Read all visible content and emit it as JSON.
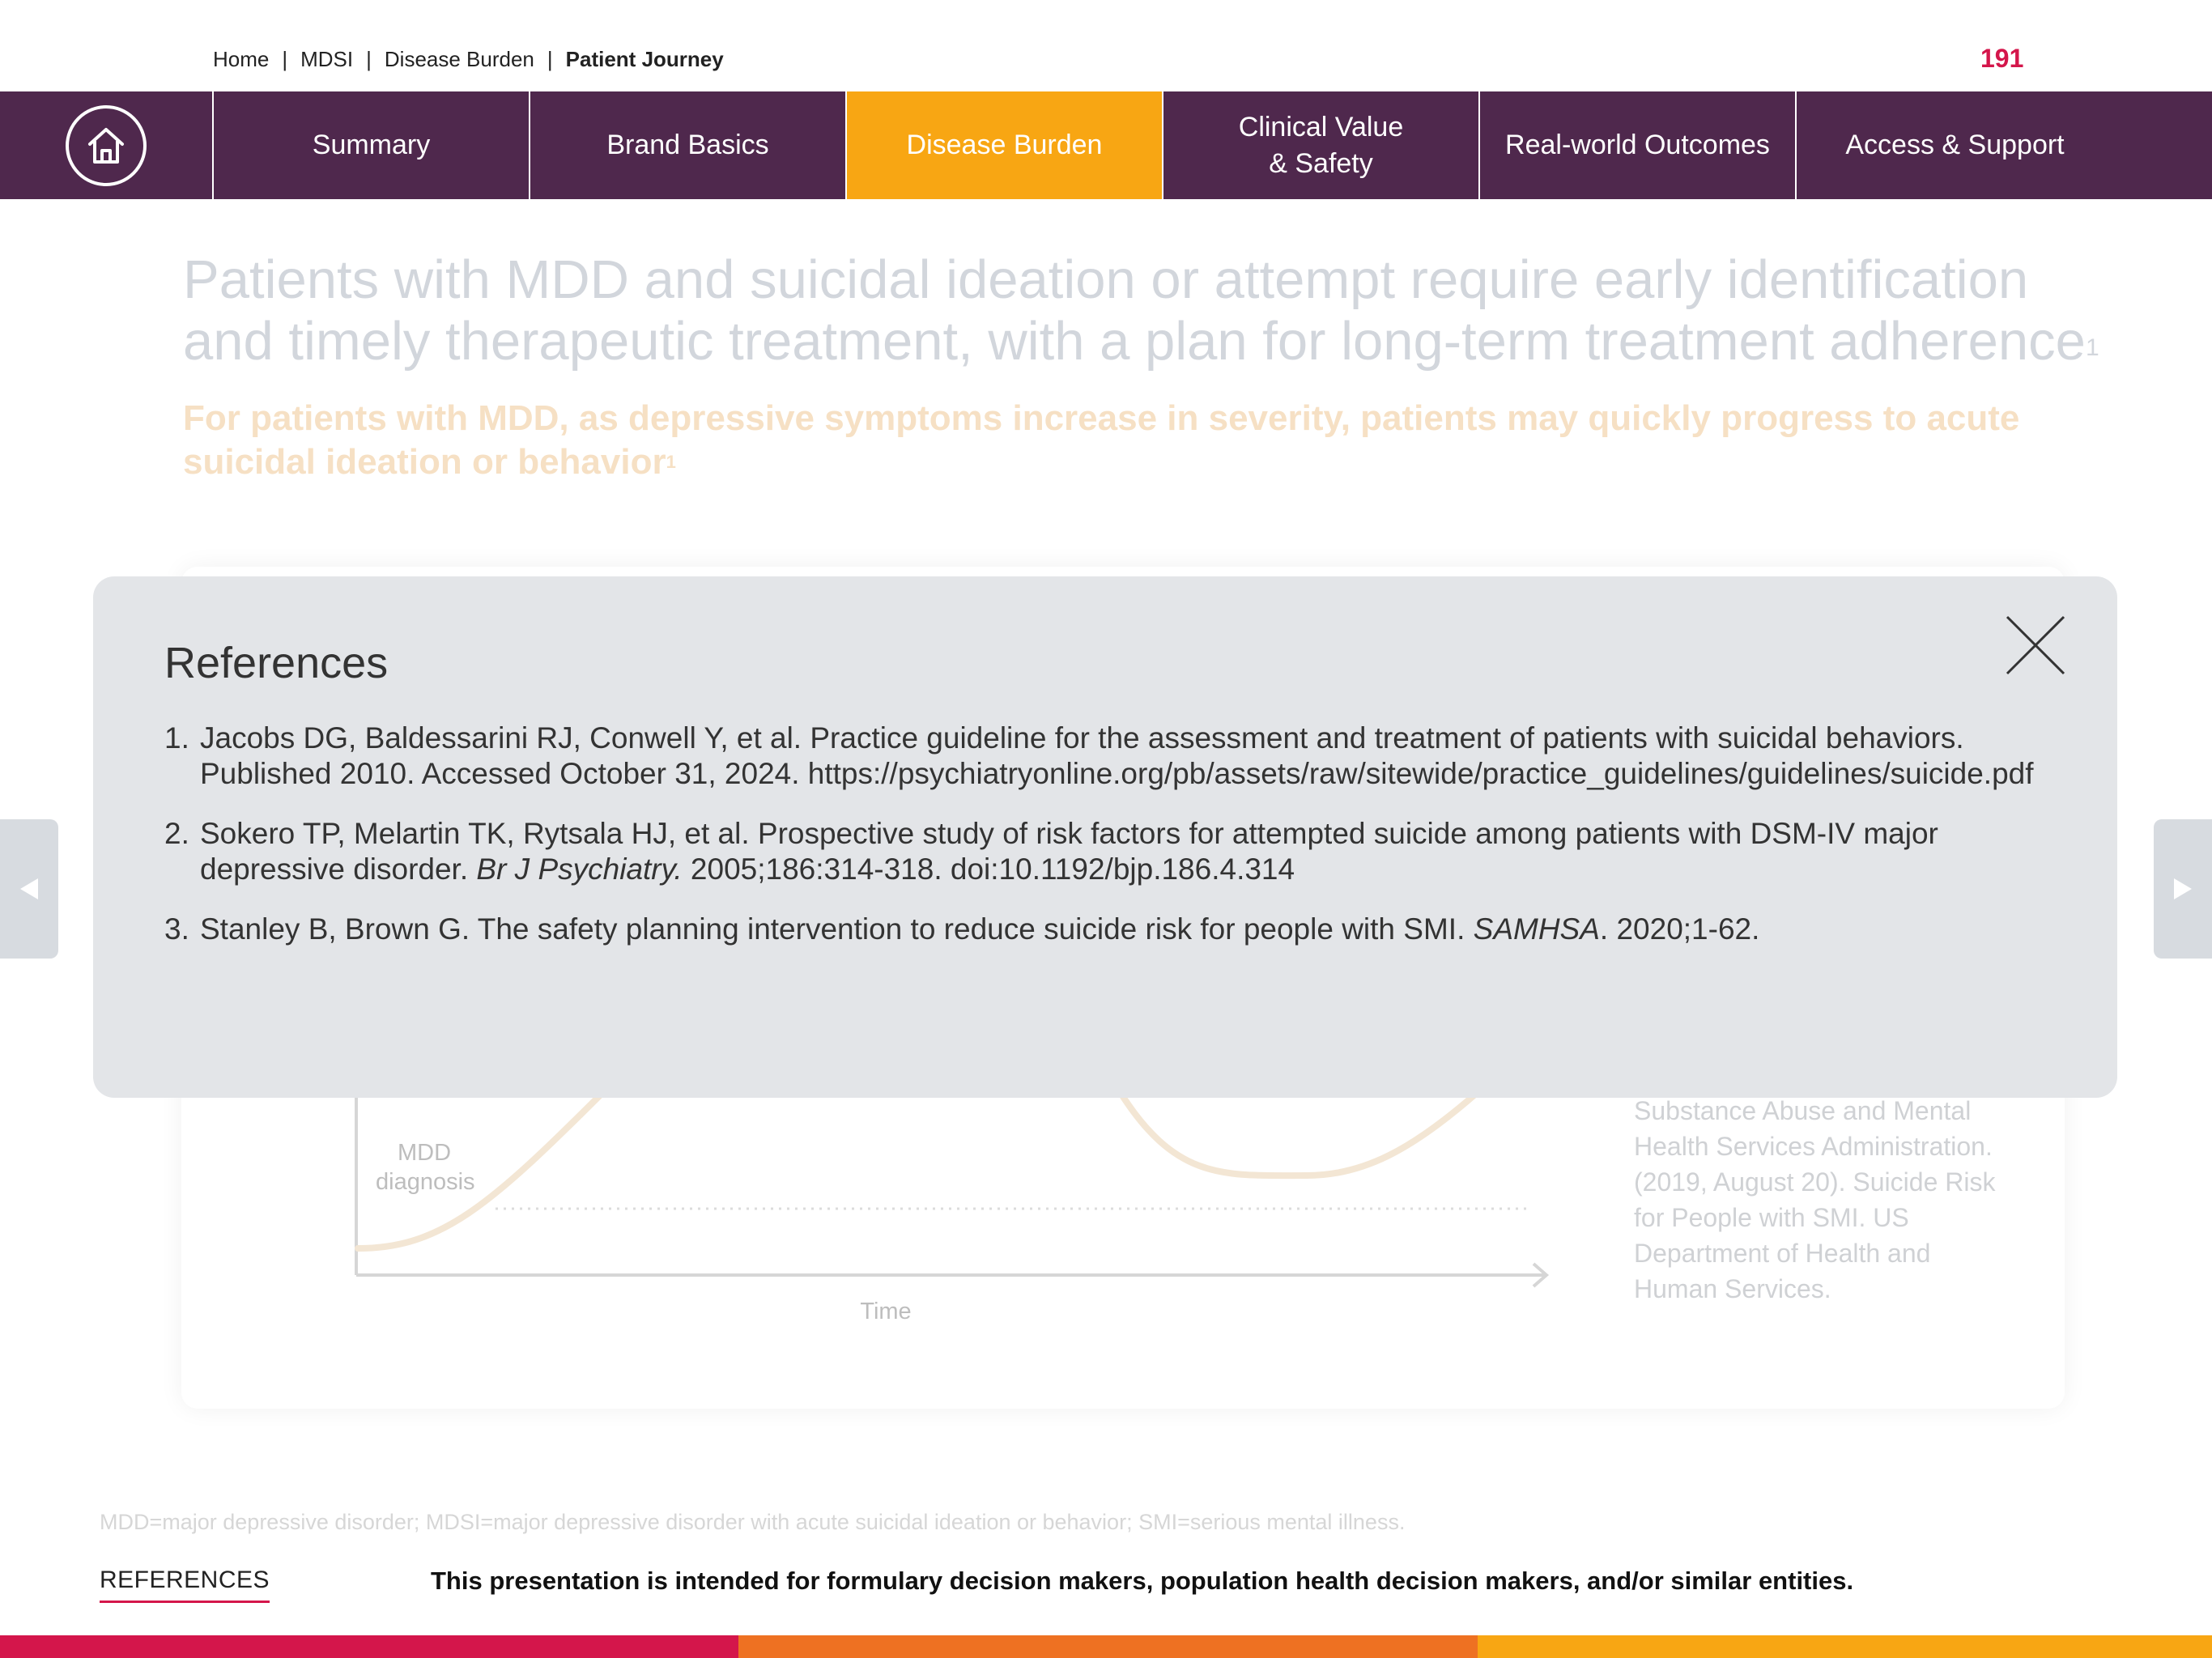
{
  "breadcrumb": {
    "home": "Home",
    "mdsi": "MDSI",
    "disease_burden": "Disease Burden",
    "current": "Patient Journey",
    "separator": "|"
  },
  "page_number": "191",
  "nav": {
    "home_icon": "home-icon",
    "tabs": [
      {
        "label": "Summary"
      },
      {
        "label": "Brand Basics"
      },
      {
        "label": "Disease Burden",
        "active": true
      },
      {
        "label_line1": "Clinical Value",
        "label_line2": "& Safety"
      },
      {
        "label": "Real-world Outcomes"
      },
      {
        "label": "Access & Support"
      }
    ]
  },
  "headline": {
    "text": "Patients with MDD and suicidal ideation or attempt require early identification and timely therapeutic treatment, with a plan for long-term treatment adherence",
    "sup": "1"
  },
  "subhead": {
    "text": "For patients with MDD, as depressive symptoms increase in severity, patients may quickly progress to acute suicidal ideation or behavior",
    "sup": "1"
  },
  "chart": {
    "label_mdd_line1": "MDD",
    "label_mdd_line2": "diagnosis",
    "xlabel": "Time",
    "source": "Substance Abuse and Mental Health Services Administration. (2019, August 20). Suicide Risk for People with SMI. US Department of Health and Human Services."
  },
  "modal": {
    "title": "References",
    "close_icon": "close-icon",
    "references": [
      {
        "num": "1.",
        "text": "Jacobs DG, Baldessarini RJ, Conwell Y, et al. Practice guideline for the assessment and treatment of patients with suicidal behaviors. Published 2010. Accessed October 31, 2024. https://psychiatryonline.org/pb/assets/raw/sitewide/practice_guidelines/guidelines/suicide.pdf"
      },
      {
        "num": "2.",
        "text_before": "Sokero TP, Melartin TK, Rytsala HJ, et al. Prospective study of risk factors for attempted suicide among patients with DSM-IV major depressive disorder. ",
        "italic": "Br J Psychiatry.",
        "text_after": " 2005;186:314-318. doi:10.1192/bjp.186.4.314"
      },
      {
        "num": "3.",
        "text_before": "Stanley B, Brown G. The safety planning intervention to reduce suicide risk for people with SMI. ",
        "italic": "SAMHSA",
        "text_after": ". 2020;1-62."
      }
    ]
  },
  "footer": {
    "abbreviations": "MDD=major depressive disorder; MDSI=major depressive disorder with acute suicidal ideation or behavior; SMI=serious mental illness.",
    "references_link": "REFERENCES",
    "disclaimer": "This presentation is intended for formulary decision makers, population health decision makers, and/or similar entities."
  },
  "arrows": {
    "prev_icon": "chevron-left-icon",
    "next_icon": "chevron-right-icon"
  },
  "colors": {
    "nav_bg": "#4f284d",
    "nav_active": "#f8a613",
    "accent_red": "#d4164b",
    "bar_red": "#d4164b",
    "bar_orange": "#ee7122",
    "bar_yellow": "#f8a613",
    "modal_bg": "#e3e5e8"
  }
}
